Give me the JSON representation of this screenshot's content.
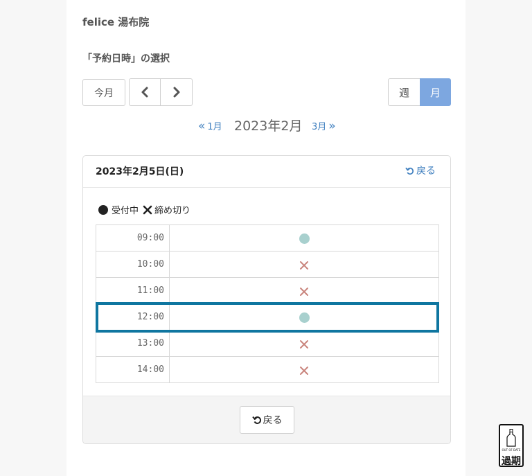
{
  "shop": {
    "name": "felice 湯布院"
  },
  "section": {
    "title": "「予約日時」の選択"
  },
  "toolbar": {
    "today_label": "今月",
    "prev_icon": "chevron-left-icon",
    "next_icon": "chevron-right-icon",
    "week_label": "週",
    "month_label": "月",
    "active_view": "月",
    "active_color": "#7da7e0"
  },
  "month_nav": {
    "prev_label": "1月",
    "current_label": "2023年2月",
    "next_label": "3月"
  },
  "panel": {
    "date_label": "2023年2月5日(日)",
    "back_label": "戻る",
    "legend": {
      "available_label": "受付中",
      "closed_label": "締め切り"
    },
    "slots": [
      {
        "time": "09:00",
        "status": "available"
      },
      {
        "time": "10:00",
        "status": "closed"
      },
      {
        "time": "11:00",
        "status": "closed"
      },
      {
        "time": "12:00",
        "status": "available",
        "highlighted": true
      },
      {
        "time": "13:00",
        "status": "closed"
      },
      {
        "time": "14:00",
        "status": "closed"
      }
    ],
    "footer_back_label": "戻る"
  },
  "badge": {
    "small_text": "OUT OF DATE",
    "big_text": "過期"
  },
  "colors": {
    "available": "#a8d0ce",
    "closed": "#c9857d",
    "link": "#3f7fbf",
    "highlight": "#0f76a0"
  }
}
